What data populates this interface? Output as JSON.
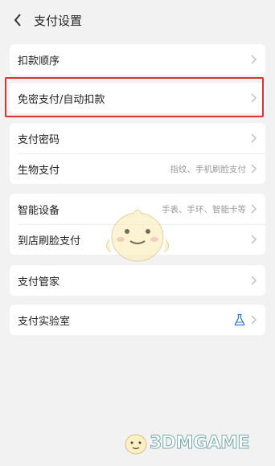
{
  "header": {
    "title": "支付设置"
  },
  "groups": [
    {
      "items": [
        {
          "label": "扣款顺序"
        }
      ]
    },
    {
      "items": [
        {
          "label": "免密支付/自动扣款"
        }
      ]
    },
    {
      "items": [
        {
          "label": "支付密码"
        },
        {
          "label": "生物支付",
          "detail": "指纹、手机刷脸支付"
        }
      ]
    },
    {
      "items": [
        {
          "label": "智能设备",
          "detail": "手表、手环、智能卡等"
        },
        {
          "label": "到店刷脸支付"
        }
      ]
    },
    {
      "items": [
        {
          "label": "支付管家"
        }
      ]
    },
    {
      "items": [
        {
          "label": "支付实验室",
          "icon": "flask-icon"
        }
      ]
    }
  ],
  "watermark": {
    "text": "3DMGAME"
  },
  "colors": {
    "highlight": "#e0302b",
    "flask": "#2a7ae2"
  }
}
